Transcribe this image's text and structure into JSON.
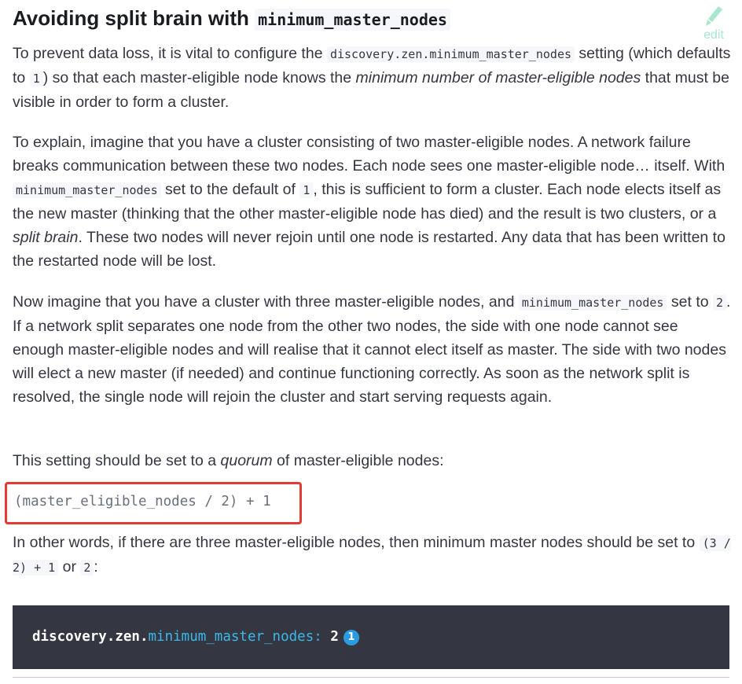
{
  "section": {
    "title": "Avoiding split brain with ",
    "title_code": "minimum_master_nodes",
    "edit_label": "edit"
  },
  "p1": {
    "t1": "To prevent data loss, it is vital to configure the ",
    "c1": "discovery.zen.minimum_master_nodes",
    "t2": " setting (which defaults to ",
    "c2": "1",
    "t3": ") so that each master-eligible node knows the ",
    "em1": "minimum number of master-eligible nodes",
    "t4": " that must be visible in order to form a cluster."
  },
  "p2": {
    "t1": "To explain, imagine that you have a cluster consisting of two master-eligible nodes. A network failure breaks communication between these two nodes. Each node sees one master-eligible node… itself. With ",
    "c1": "minimum_master_nodes",
    "t2": " set to the default of ",
    "c2": "1",
    "t3": ", this is sufficient to form a cluster. Each node elects itself as the new master (thinking that the other master-eligible node has died) and the result is two clusters, or a ",
    "em1": "split brain",
    "t4": ". These two nodes will never rejoin until one node is restarted. Any data that has been written to the restarted node will be lost."
  },
  "p3": {
    "t1": "Now imagine that you have a cluster with three master-eligible nodes, and ",
    "c1": "minimum_master_nodes",
    "t2": " set to ",
    "c2": "2",
    "t3": ". If a network split separates one node from the other two nodes, the side with one node cannot see enough master-eligible nodes and will realise that it cannot elect itself as master. The side with two nodes will elect a new master (if needed) and continue functioning correctly. As soon as the network split is resolved, the single node will rejoin the cluster and start serving requests again."
  },
  "p4": {
    "t1": "This setting should be set to a ",
    "em1": "quorum",
    "t2": " of master-eligible nodes:"
  },
  "formula": "(master_eligible_nodes / 2) + 1",
  "p5": {
    "t1": "In other words, if there are three master-eligible nodes, then minimum master nodes should be set to ",
    "c1": "(3 / 2) + 1",
    "t2": " or ",
    "c2": "2",
    "t3": ":"
  },
  "codeblock": {
    "prefix": "discovery.zen.",
    "key": "minimum_master_nodes:",
    "value": " 2",
    "callout": "1"
  },
  "colors": {
    "highlight_box": "#e53935",
    "code_bg": "#343741",
    "code_key": "#3bb8ea",
    "callout": "#2a9be0",
    "edit": "#a8e6ce"
  },
  "icons": {
    "edit": "pencil-icon"
  }
}
